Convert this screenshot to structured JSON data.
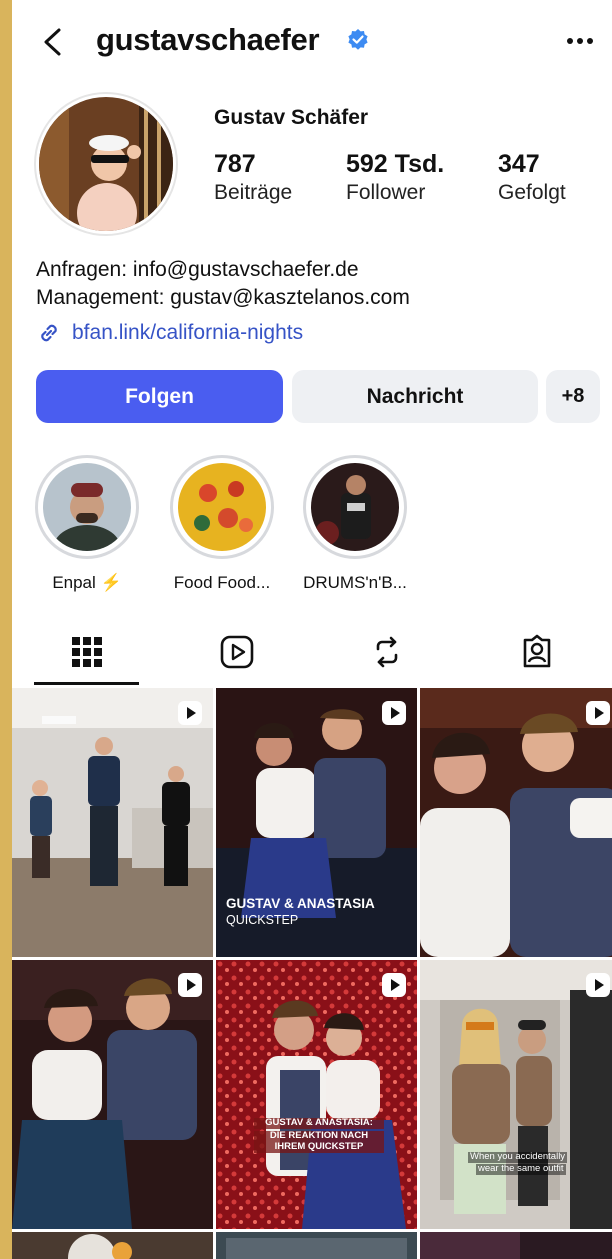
{
  "header": {
    "username": "gustavschaefer"
  },
  "profile": {
    "display_name": "Gustav Schäfer",
    "stats": [
      {
        "value": "787",
        "label": "Beiträge"
      },
      {
        "value": "592 Tsd.",
        "label": "Follower"
      },
      {
        "value": "347",
        "label": "Gefolgt"
      }
    ],
    "bio_line1": "Anfragen: info@gustavschaefer.de",
    "bio_line2": "Management: gustav@kasztelanos.com",
    "link": "bfan.link/california-nights"
  },
  "actions": {
    "follow": "Folgen",
    "message": "Nachricht",
    "add_person": "+8"
  },
  "highlights": [
    {
      "label": "Enpal ⚡"
    },
    {
      "label": "Food Food..."
    },
    {
      "label": "DRUMS'n'B..."
    }
  ],
  "tabs": [
    "grid-icon",
    "reels-icon",
    "reposts-icon",
    "tagged-icon"
  ],
  "posts": [
    {
      "overlay_title": "",
      "overlay_sub": ""
    },
    {
      "overlay_title": "GUSTAV & ANASTASIA",
      "overlay_sub": "QUICKSTEP"
    },
    {
      "overlay_title": "",
      "overlay_sub": ""
    },
    {
      "overlay_title": "",
      "overlay_sub": ""
    },
    {
      "overlay_title": "GUSTAV & ANASTASIA:",
      "overlay_sub": "DIE REAKTION NACH IHREM QUICKSTEP"
    },
    {
      "overlay_title": "When you accidentally",
      "overlay_sub": "wear the same outfit"
    }
  ],
  "colors": {
    "accent": "#4a5df0",
    "link": "#3653c6",
    "verified": "#3d8bf2",
    "frame": "#d9b45c"
  }
}
